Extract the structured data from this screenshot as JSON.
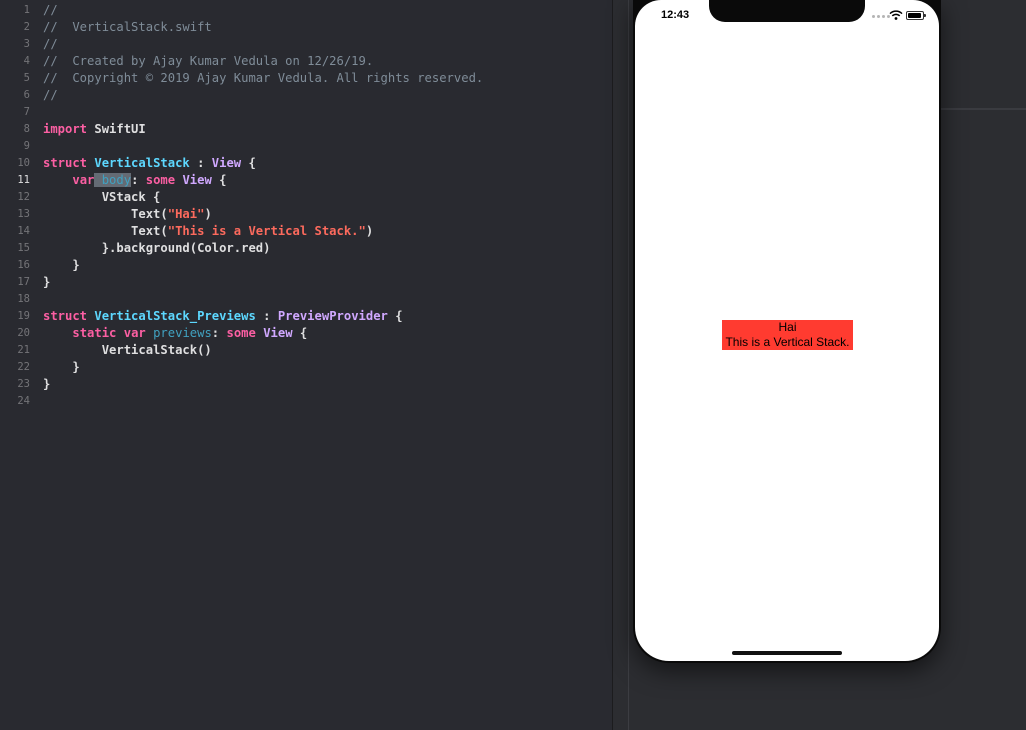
{
  "editor": {
    "line_numbers": [
      "1",
      "2",
      "3",
      "4",
      "5",
      "6",
      "7",
      "8",
      "9",
      "10",
      "11",
      "12",
      "13",
      "14",
      "15",
      "16",
      "17",
      "18",
      "19",
      "20",
      "21",
      "22",
      "23",
      "24"
    ],
    "current_line": "11",
    "lines": [
      [
        {
          "t": "//",
          "c": "comment"
        }
      ],
      [
        {
          "t": "//  VerticalStack.swift",
          "c": "comment"
        }
      ],
      [
        {
          "t": "//",
          "c": "comment"
        }
      ],
      [
        {
          "t": "//  Created by Ajay Kumar Vedula on 12/26/19.",
          "c": "comment"
        }
      ],
      [
        {
          "t": "//  Copyright © 2019 Ajay Kumar Vedula. All rights reserved.",
          "c": "comment"
        }
      ],
      [
        {
          "t": "//",
          "c": "comment"
        }
      ],
      [],
      [
        {
          "t": "import",
          "c": "kw"
        },
        {
          "t": " SwiftUI",
          "c": "plain"
        }
      ],
      [],
      [
        {
          "t": "struct",
          "c": "kw"
        },
        {
          "t": " ",
          "c": "plain"
        },
        {
          "t": "VerticalStack",
          "c": "type"
        },
        {
          "t": " : ",
          "c": "plain"
        },
        {
          "t": "View",
          "c": "sys"
        },
        {
          "t": " {",
          "c": "plain"
        }
      ],
      [
        {
          "t": "    ",
          "c": "plain"
        },
        {
          "t": "var",
          "c": "kw"
        },
        {
          "t": " body",
          "c": "hl"
        },
        {
          "t": ": ",
          "c": "plain"
        },
        {
          "t": "some",
          "c": "kw"
        },
        {
          "t": " ",
          "c": "plain"
        },
        {
          "t": "View",
          "c": "sys"
        },
        {
          "t": " {",
          "c": "plain"
        }
      ],
      [
        {
          "t": "        VStack {",
          "c": "plain"
        }
      ],
      [
        {
          "t": "            Text(",
          "c": "plain"
        },
        {
          "t": "\"Hai\"",
          "c": "str"
        },
        {
          "t": ")",
          "c": "plain"
        }
      ],
      [
        {
          "t": "            Text(",
          "c": "plain"
        },
        {
          "t": "\"This is a Vertical Stack.\"",
          "c": "str"
        },
        {
          "t": ")",
          "c": "plain"
        }
      ],
      [
        {
          "t": "        }.background(Color.red)",
          "c": "plain"
        }
      ],
      [
        {
          "t": "    }",
          "c": "plain"
        }
      ],
      [
        {
          "t": "}",
          "c": "plain"
        }
      ],
      [],
      [
        {
          "t": "struct",
          "c": "kw"
        },
        {
          "t": " ",
          "c": "plain"
        },
        {
          "t": "VerticalStack_Previews",
          "c": "type"
        },
        {
          "t": " : ",
          "c": "plain"
        },
        {
          "t": "PreviewProvider",
          "c": "sys"
        },
        {
          "t": " {",
          "c": "plain"
        }
      ],
      [
        {
          "t": "    ",
          "c": "plain"
        },
        {
          "t": "static",
          "c": "kw"
        },
        {
          "t": " ",
          "c": "plain"
        },
        {
          "t": "var",
          "c": "kw"
        },
        {
          "t": " ",
          "c": "plain"
        },
        {
          "t": "previews",
          "c": "var"
        },
        {
          "t": ": ",
          "c": "plain"
        },
        {
          "t": "some",
          "c": "kw"
        },
        {
          "t": " ",
          "c": "plain"
        },
        {
          "t": "View",
          "c": "sys"
        },
        {
          "t": " {",
          "c": "plain"
        }
      ],
      [
        {
          "t": "        VerticalStack()",
          "c": "plain"
        }
      ],
      [
        {
          "t": "    }",
          "c": "plain"
        }
      ],
      [
        {
          "t": "}",
          "c": "plain"
        }
      ],
      []
    ]
  },
  "preview": {
    "status_time": "12:43",
    "vstack": {
      "text1": "Hai",
      "text2": "This is a Vertical Stack.",
      "background_color": "#ff3b30"
    },
    "icons": [
      "signal-icon",
      "wifi-icon",
      "battery-icon"
    ]
  },
  "colors": {
    "editor_bg": "#292a30",
    "comment": "#7f8c98",
    "keyword": "#fc5fa3",
    "type": "#5dd8ff",
    "string": "#fc6a5d"
  }
}
